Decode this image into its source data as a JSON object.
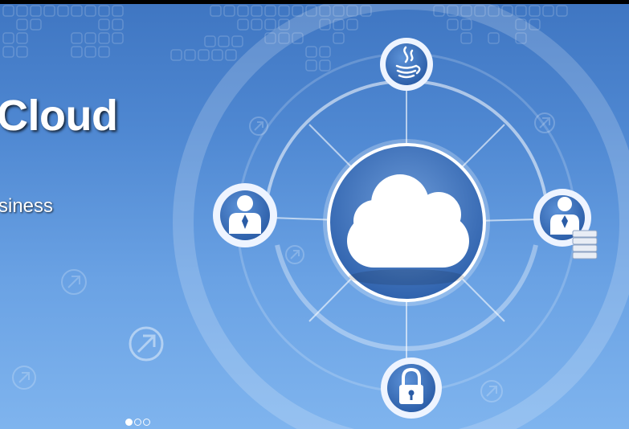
{
  "hero": {
    "title": "Cloud",
    "subtitle": "siness"
  },
  "carousel": {
    "slides": [
      {
        "active": true
      },
      {
        "active": false
      },
      {
        "active": false
      }
    ]
  },
  "colors": {
    "sky_top": "#3f76c2",
    "sky_bottom": "#7fb4ee",
    "node_dark": "#2d5fa6",
    "node_light": "#eef4ff",
    "cloud": "#ffffff"
  },
  "icons": {
    "center": "cloud-icon",
    "top": "java-coffee-icon",
    "left": "user-icon",
    "right": "user-database-icon",
    "bottom": "lock-icon"
  }
}
